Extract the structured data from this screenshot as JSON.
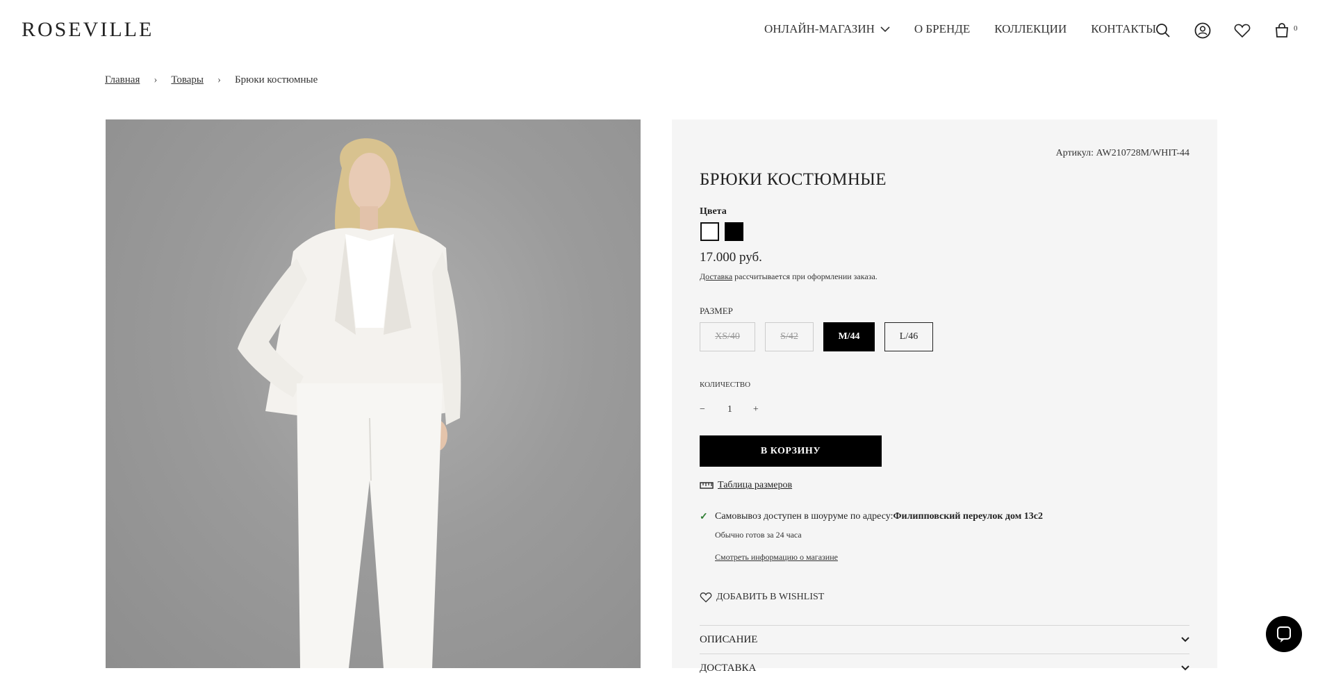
{
  "header": {
    "logo": "ROSEVILLE",
    "nav": [
      {
        "label": "ОНЛАЙН-МАГАЗИН",
        "has_dropdown": true
      },
      {
        "label": "О БРЕНДЕ"
      },
      {
        "label": "КОЛЛЕКЦИИ"
      },
      {
        "label": "КОНТАКТЫ"
      }
    ],
    "icons": [
      "search-icon",
      "account-icon",
      "wishlist-heart-icon",
      "cart-bag-icon"
    ],
    "cart_count": "0"
  },
  "breadcrumb": {
    "items": [
      "Главная",
      "Товары",
      "Брюки костюмные"
    ],
    "separator": "›"
  },
  "product": {
    "sku": "Артикул: AW210728M/WHIT-44",
    "title": "БРЮКИ КОСТЮМНЫЕ",
    "colors_label": "Цвета",
    "colors": [
      {
        "name": "white",
        "hex": "#ffffff",
        "selected": true
      },
      {
        "name": "black",
        "hex": "#000000",
        "selected": false
      }
    ],
    "price": "17.000 руб.",
    "delivery_link": "Доставка",
    "delivery_text": " рассчитывается при оформлении заказа.",
    "size_label": "РАЗМЕР",
    "sizes": [
      {
        "label": "XS/40",
        "state": "disabled"
      },
      {
        "label": "S/42",
        "state": "disabled"
      },
      {
        "label": "M/44",
        "state": "selected"
      },
      {
        "label": "L/46",
        "state": "available"
      }
    ],
    "qty_label": "КОЛИЧЕСТВО",
    "qty_minus": "−",
    "qty_value": "1",
    "qty_plus": "+",
    "add_to_cart": "В КОРЗИНУ",
    "size_table": "Таблица размеров",
    "pickup_text": "Самовывоз доступен в шоуруме по адресу: ",
    "pickup_address": "Филипповский переулок дом 13с2",
    "ready_text": "Обычно готов за 24 часа",
    "store_info_link": "Смотреть информацию о магазине",
    "wishlist": "ДОБАВИТЬ В WISHLIST",
    "accordion": [
      {
        "label": "ОПИСАНИЕ"
      },
      {
        "label": "ДОСТАВКА"
      }
    ]
  },
  "colors": {
    "accent": "#000000",
    "panel_bg": "#f5f5f5",
    "check_green": "#2e7d32"
  }
}
